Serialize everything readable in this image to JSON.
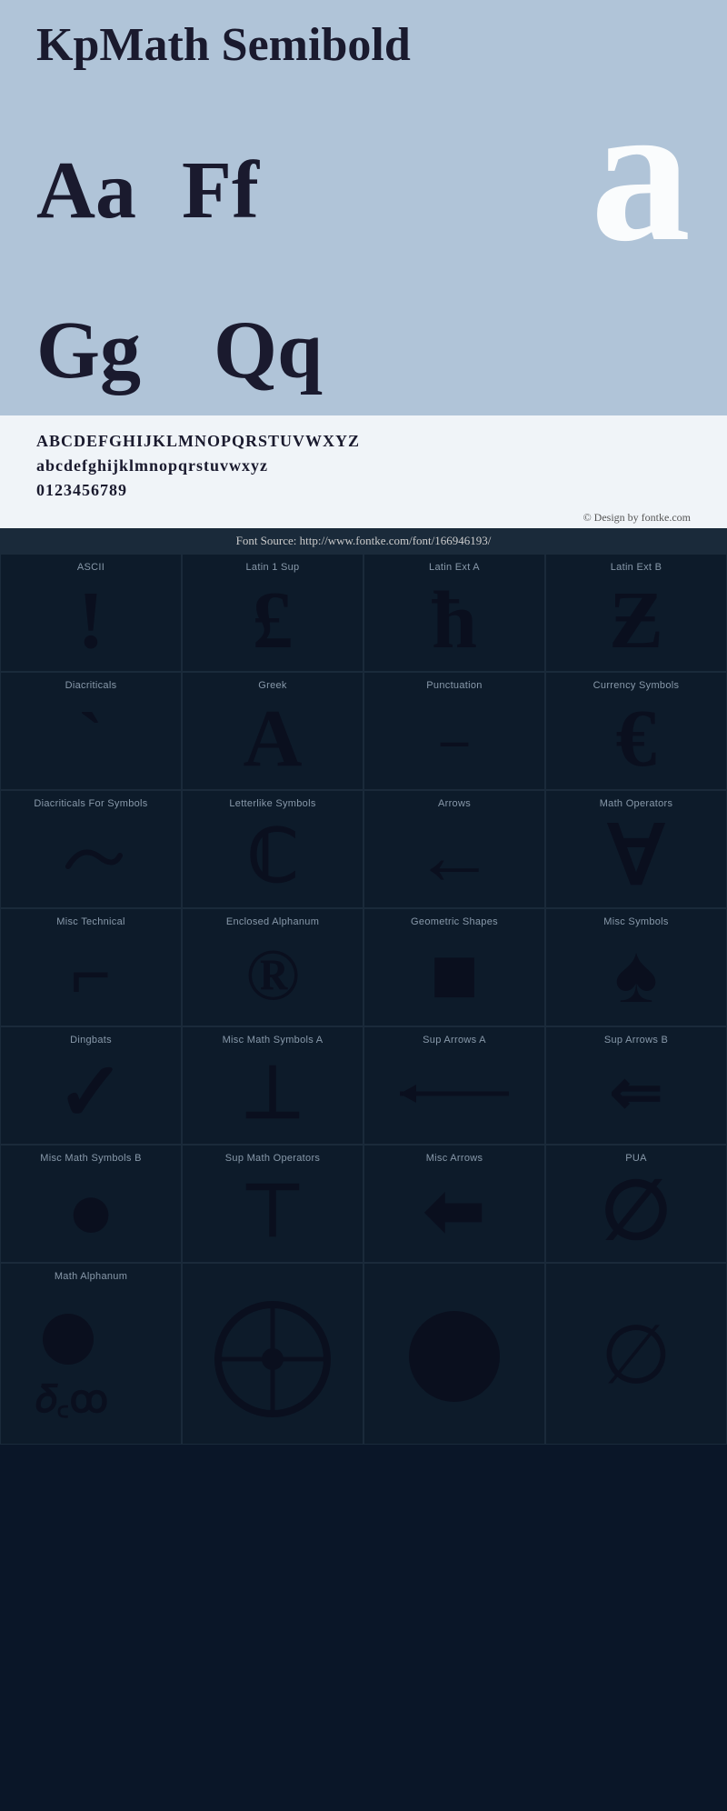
{
  "header": {
    "title": "KpMath Semibold",
    "letter_pairs": [
      {
        "pair": "Aa"
      },
      {
        "pair": "Ff"
      }
    ],
    "letter_pairs2": [
      {
        "pair": "Gg"
      },
      {
        "pair": "Qq"
      }
    ],
    "large_letter": "a",
    "alphabet_upper": "ABCDEFGHIJKLMNOPQRSTUVWXYZ",
    "alphabet_lower": "abcdefghijklmnopqrstuvwxyz",
    "digits": "0123456789",
    "credit": "© Design by fontke.com",
    "source": "Font Source: http://www.fontke.com/font/166946193/"
  },
  "glyphs": [
    {
      "label": "ASCII",
      "symbol": "!",
      "size": "xl"
    },
    {
      "label": "Latin 1 Sup",
      "symbol": "£",
      "size": "xl"
    },
    {
      "label": "Latin Ext A",
      "symbol": "ħ",
      "size": "xl"
    },
    {
      "label": "Latin Ext B",
      "symbol": "Ƶ",
      "size": "xl"
    },
    {
      "label": "Diacriticals",
      "symbol": "`",
      "size": "xl"
    },
    {
      "label": "Greek",
      "symbol": "Α",
      "size": "xl"
    },
    {
      "label": "Punctuation",
      "symbol": "–",
      "size": "xl"
    },
    {
      "label": "Currency Symbols",
      "symbol": "€",
      "size": "xl"
    },
    {
      "label": "Diacriticals For Symbols",
      "symbol": "˜",
      "size": "lg"
    },
    {
      "label": "Letterlike Symbols",
      "symbol": "℃",
      "size": "xl"
    },
    {
      "label": "Arrows",
      "symbol": "←",
      "size": "xl"
    },
    {
      "label": "Math Operators",
      "symbol": "∀",
      "size": "xl"
    },
    {
      "label": "Misc Technical",
      "symbol": "⌐",
      "size": "xl"
    },
    {
      "label": "Enclosed Alphanum",
      "symbol": "®",
      "size": "xl"
    },
    {
      "label": "Geometric Shapes",
      "symbol": "■",
      "size": "xl"
    },
    {
      "label": "Misc Symbols",
      "symbol": "♠",
      "size": "xl"
    },
    {
      "label": "Dingbats",
      "symbol": "✓",
      "size": "xl"
    },
    {
      "label": "Misc Math Symbols A",
      "symbol": "⊥",
      "size": "xl"
    },
    {
      "label": "Sup Arrows A",
      "symbol": "⟵",
      "size": "lg"
    },
    {
      "label": "Sup Arrows B",
      "symbol": "⇐",
      "size": "xl"
    },
    {
      "label": "Misc Math Symbols B",
      "symbol": "●",
      "size": "xl"
    },
    {
      "label": "Sup Math Operators",
      "symbol": "⊤",
      "size": "xl"
    },
    {
      "label": "Misc Arrows",
      "symbol": "⬅",
      "size": "xl"
    },
    {
      "label": "PUA",
      "symbol": "∅",
      "size": "xl"
    },
    {
      "label": "Math Alphanum",
      "symbol": "𝛿",
      "size": "xl"
    },
    {
      "label": "",
      "symbol": "",
      "size": "xl"
    },
    {
      "label": "",
      "symbol": "⊙",
      "size": "xl"
    },
    {
      "label": "",
      "symbol": "",
      "size": "xl"
    }
  ]
}
